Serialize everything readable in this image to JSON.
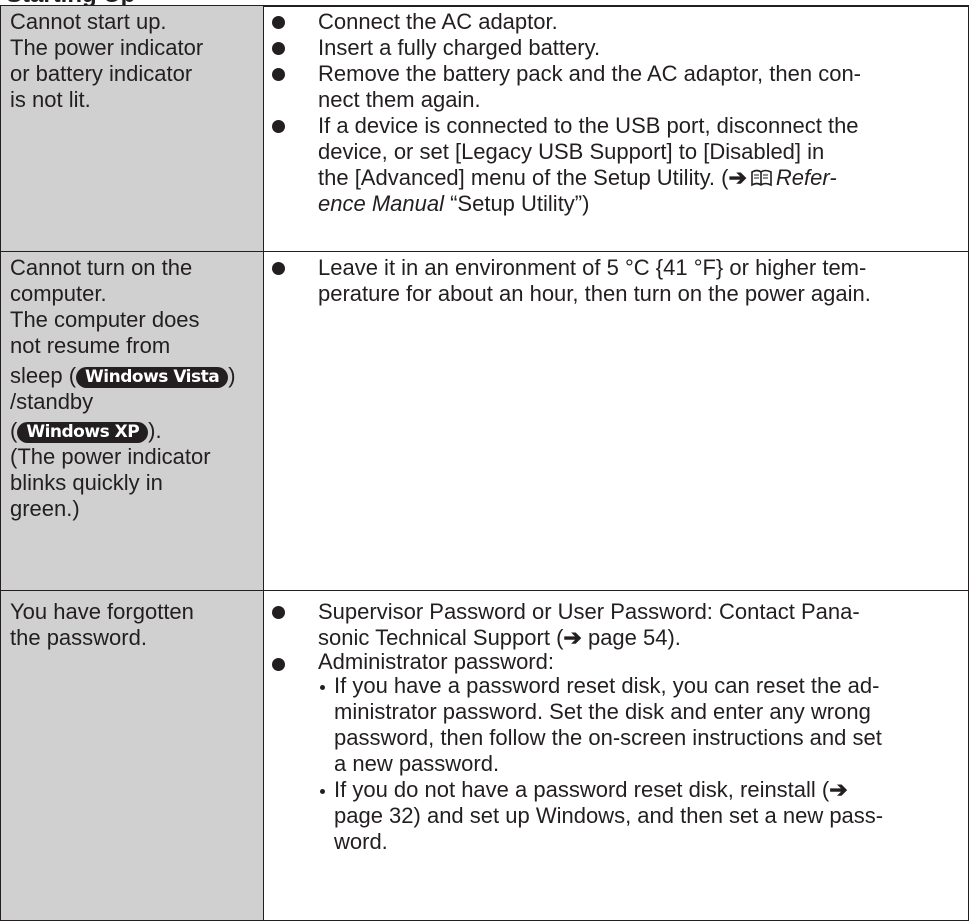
{
  "header": {
    "title_fragment": "Starting Up"
  },
  "rows": [
    {
      "problem": [
        "Cannot start up.",
        "The power indicator",
        "or battery indicator",
        "is not lit."
      ],
      "solutions": {
        "s1": "Connect the AC adaptor.",
        "s2": "Insert a fully charged battery.",
        "s3a": "Remove the battery pack and the AC adaptor, then con-",
        "s3b": "nect them again.",
        "s4a": "If a device is connected to the USB port, disconnect the",
        "s4b": "device, or set [Legacy USB Support] to [Disabled] in",
        "s4c": "the [Advanced] menu of the Setup Utility. (",
        "s4c_ital": "Refer-",
        "s4d_ital": "ence Manual",
        "s4d": " “Setup Utility”)",
        "arrow_glyph": "➔"
      }
    },
    {
      "problem": {
        "l1": "Cannot turn on the",
        "l2": "computer.",
        "l3": "The computer does",
        "l4": "not resume from",
        "l5_pre": "sleep (",
        "badge_vista": "Windows Vista",
        "l5_post": ")",
        "l6": "/standby",
        "l7_pre": "(",
        "badge_xp": "Windows XP",
        "l7_post": ").",
        "l8": "(The power indicator",
        "l9": "blinks quickly in",
        "l10": "green.)"
      },
      "solutions": {
        "s1a": "Leave it in an environment of 5 °C {41 °F} or higher tem-",
        "s1b": "perature for about an hour, then turn on the power again."
      }
    },
    {
      "problem": [
        "You have forgotten",
        "the password."
      ],
      "solutions": {
        "s1a": "Supervisor Password or User Password: Contact Pana-",
        "s1b_pre": "sonic Technical Support (",
        "s1b_post": " page 54).",
        "s2": "Administrator password:",
        "sub1a": "If you have a password reset disk, you can reset the ad-",
        "sub1b": "ministrator password. Set the disk and enter any wrong",
        "sub1c": "password, then follow the on-screen instructions and set",
        "sub1d": "a new password.",
        "sub2a_pre": "If you do not have a password reset disk, reinstall (",
        "sub2b": "page 32) and set up Windows, and then set a new pass-",
        "sub2c": "word.",
        "arrow_glyph": "➔"
      }
    }
  ]
}
